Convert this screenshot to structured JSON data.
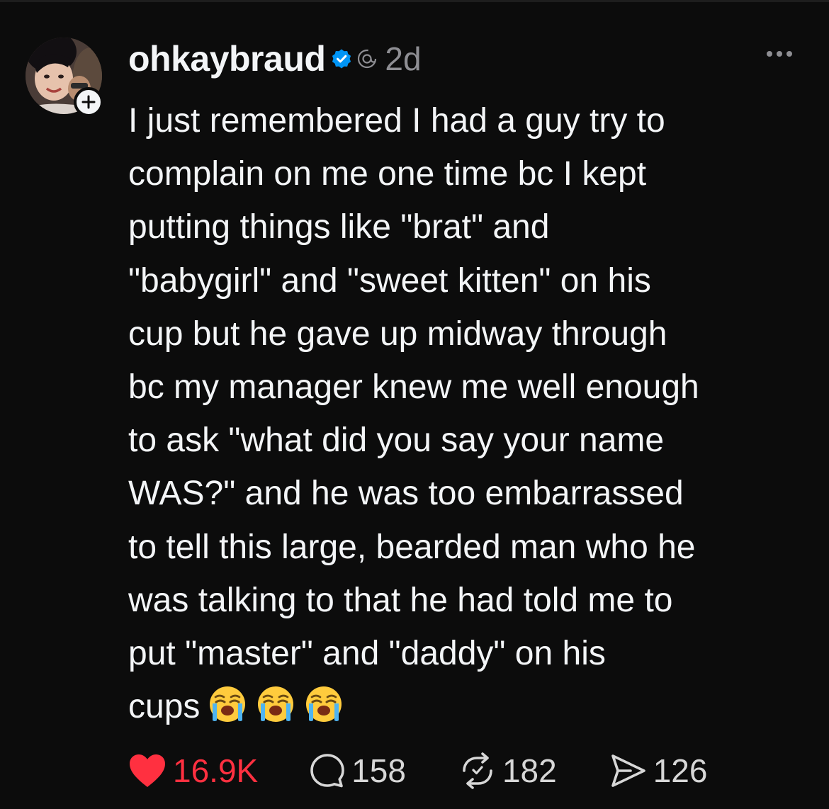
{
  "post": {
    "author": {
      "username": "ohkaybraud",
      "verified": true,
      "avatar": "profile-photo",
      "follow_icon": "plus-icon"
    },
    "time": "2d",
    "body_lines": [
      "I just remembered I had a guy try to",
      "complain on me one time bc I kept",
      "putting things like \"brat\" and",
      "\"babygirl\" and \"sweet kitten\" on his",
      "cup but he gave up midway through",
      "bc my manager knew me well enough",
      "to ask \"what did you say your name",
      "WAS?\" and he was too embarrassed",
      "to tell this large, bearded man who he",
      "was talking to that he had told me to",
      "put \"master\" and \"daddy\" on his",
      "cups"
    ],
    "emojis": [
      "loudly-crying-face",
      "loudly-crying-face",
      "loudly-crying-face"
    ],
    "actions": {
      "likes": "16.9K",
      "replies": "158",
      "reposts": "182",
      "shares": "126"
    }
  },
  "colors": {
    "background": "#0c0c0c",
    "text": "#f3f5f7",
    "muted": "#8e8e93",
    "like": "#ff3040",
    "verified": "#0095f6"
  }
}
